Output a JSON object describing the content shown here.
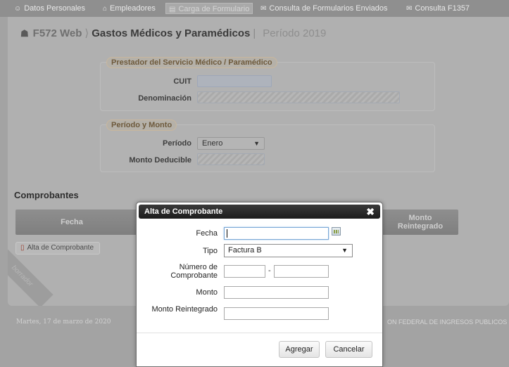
{
  "topnav": {
    "items": [
      {
        "label": "Datos Personales",
        "icon": "person-icon"
      },
      {
        "label": "Empleadores",
        "icon": "building-icon"
      },
      {
        "label": "Carga de Formulario",
        "icon": "document-icon"
      },
      {
        "label": "Consulta de Formularios Enviados",
        "icon": "envelope-icon"
      },
      {
        "label": "Consulta F1357",
        "icon": "envelope-icon"
      }
    ]
  },
  "breadcrumb": {
    "app": "F572 Web",
    "page": "Gastos Médicos y Paramédicos",
    "period": "Período 2019"
  },
  "prestador": {
    "legend": "Prestador del Servicio Médico / Paramédico",
    "cuit_label": "CUIT",
    "cuit_value": "",
    "denominacion_label": "Denominación",
    "denominacion_value": ""
  },
  "periodo_monto": {
    "legend": "Período y Monto",
    "periodo_label": "Período",
    "periodo_value": "Enero",
    "monto_label": "Monto Deducible",
    "monto_value": ""
  },
  "comprobantes": {
    "title": "Comprobantes",
    "col_fecha": "Fecha",
    "col_monto_reintegrado": "Monto Reintegrado",
    "alta_button": "Alta de Comprobante"
  },
  "watermark": "borrador",
  "footer": {
    "date": "Martes, 17 de marzo de 2020",
    "org": "ON FEDERAL DE INGRESOS PUBLICOS"
  },
  "modal": {
    "title": "Alta de Comprobante",
    "fecha_label": "Fecha",
    "fecha_value": "",
    "tipo_label": "Tipo",
    "tipo_value": "Factura B",
    "numero_label": "Número de Comprobante",
    "monto_label": "Monto",
    "monto_reintegrado_label": "Monto Reintegrado",
    "agregar": "Agregar",
    "cancelar": "Cancelar"
  }
}
